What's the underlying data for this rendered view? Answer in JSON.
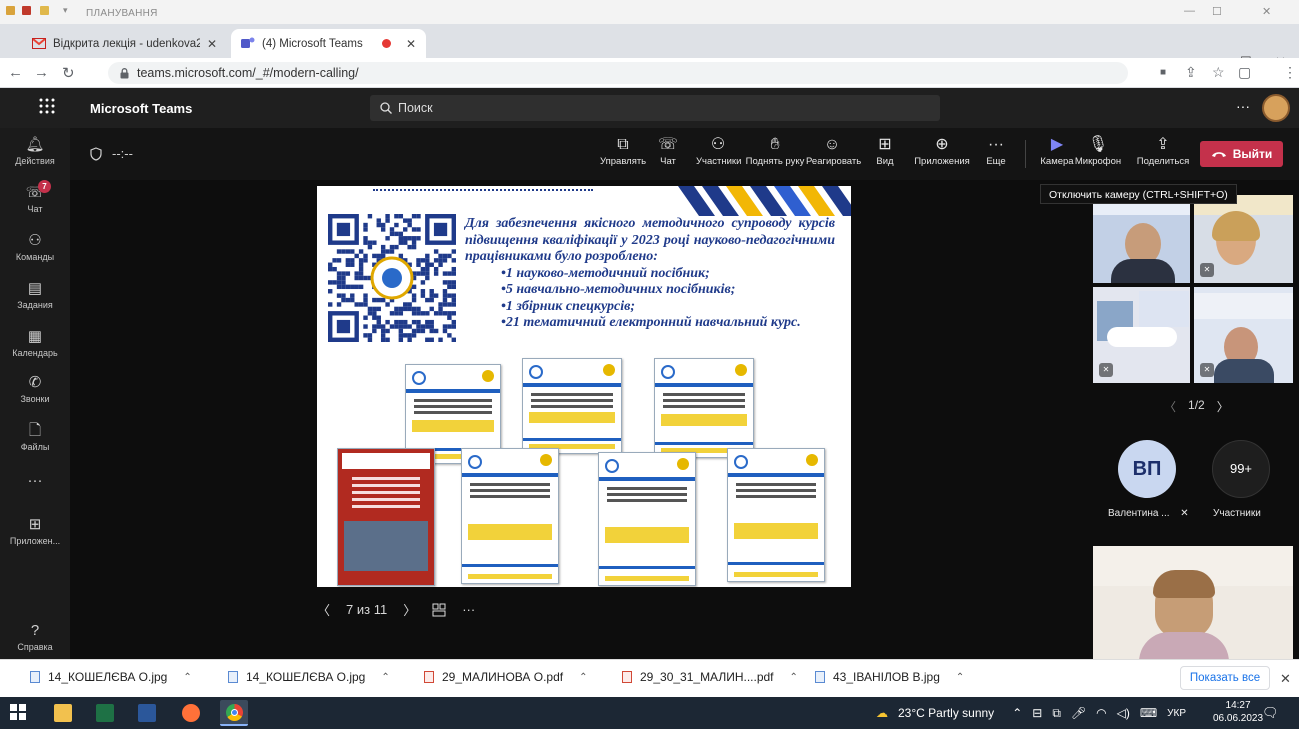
{
  "office_title": "ПЛАНУВАННЯ",
  "browser": {
    "tabs": [
      {
        "label": "Відкрита лекція - udenkova2017",
        "icon": "gmail-icon"
      },
      {
        "label": "(4) Microsoft Teams",
        "icon": "teams-icon"
      }
    ],
    "url": "teams.microsoft.com/_#/modern-calling/"
  },
  "teams": {
    "brand": "Microsoft Teams",
    "search_placeholder": "Поиск",
    "rail": [
      {
        "label": "Действия",
        "icon": "bell-icon"
      },
      {
        "label": "Чат",
        "icon": "chat-icon",
        "badge": "7"
      },
      {
        "label": "Команды",
        "icon": "teams-group-icon"
      },
      {
        "label": "Задания",
        "icon": "assignments-icon"
      },
      {
        "label": "Календарь",
        "icon": "calendar-icon"
      },
      {
        "label": "Звонки",
        "icon": "phone-icon"
      },
      {
        "label": "Файлы",
        "icon": "file-icon"
      },
      {
        "label": "...",
        "icon": "more-icon"
      },
      {
        "label": "Приложен...",
        "icon": "apps-icon"
      },
      {
        "label": "Справка",
        "icon": "help-icon"
      }
    ],
    "timer": "--:--",
    "meeting_buttons": [
      {
        "label": "Управлять",
        "icon": "present-icon"
      },
      {
        "label": "Чат",
        "icon": "chat-icon"
      },
      {
        "label": "Участники",
        "icon": "people-icon"
      },
      {
        "label": "Поднять руку",
        "icon": "raise-hand-icon"
      },
      {
        "label": "Реагировать",
        "icon": "smile-icon"
      },
      {
        "label": "Вид",
        "icon": "grid-view-icon"
      },
      {
        "label": "Приложения",
        "icon": "add-app-icon"
      },
      {
        "label": "Еще",
        "icon": "more-icon"
      },
      {
        "label": "Камера",
        "icon": "camera-icon"
      },
      {
        "label": "Микрофон",
        "icon": "mic-off-icon"
      },
      {
        "label": "Поделиться",
        "icon": "share-icon"
      }
    ],
    "leave_label": "Выйти",
    "tooltip": "Отключить камеру (CTRL+SHIFT+O)",
    "slide": {
      "intro": "Для забезпечення якісного методичного супроводу курсів підвищення кваліфікації у 2023 році науково-педагогічними працівниками було розроблено:",
      "items": [
        "•1 науково-методичний посібник;",
        "•5 навчально-методичних посібників;",
        "•1 збірник спецкурсів;",
        "•21 тематичний електронний навчальний курс."
      ]
    },
    "slide_counter": "7 из 11",
    "pager": "1/2",
    "participant_initials": "ВП",
    "participant_name": "Валентина ...",
    "participants_count": "99+",
    "participants_label": "Участники"
  },
  "downloads": {
    "files": [
      {
        "name": "14_КОШЕЛЄВА О.jpg",
        "type": "jpg"
      },
      {
        "name": "14_КОШЕЛЄВА О.jpg",
        "type": "jpg"
      },
      {
        "name": "29_МАЛИНОВА О.pdf",
        "type": "pdf"
      },
      {
        "name": "29_30_31_МАЛИН....pdf",
        "type": "pdf"
      },
      {
        "name": "43_ІВАНІЛОВ В.jpg",
        "type": "jpg"
      }
    ],
    "show_all": "Показать все"
  },
  "taskbar": {
    "weather": "23°C  Partly sunny",
    "lang": "УКР",
    "time": "14:27",
    "date": "06.06.2023"
  },
  "colors": {
    "leave": "#c4314b",
    "teams_header": "#1f1f1f",
    "slide_text": "#1f3a8a",
    "taskbar": "#1c2734"
  }
}
